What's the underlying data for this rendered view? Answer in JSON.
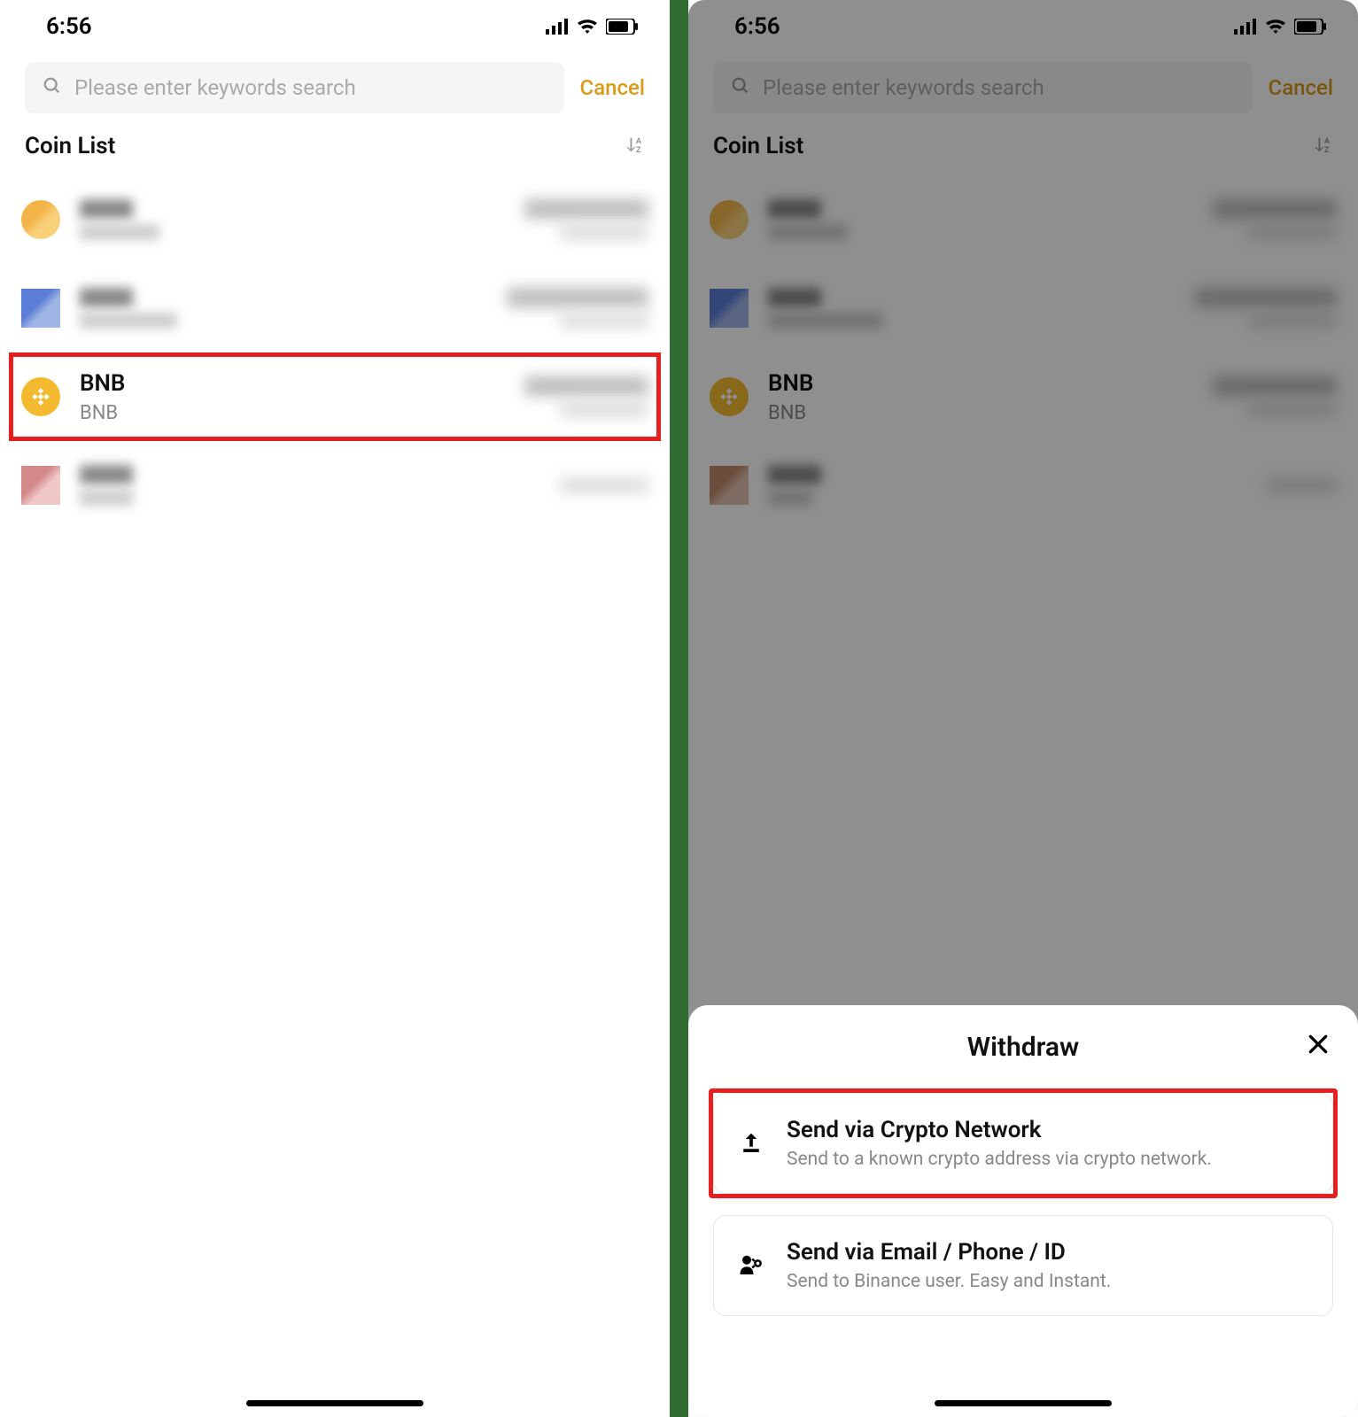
{
  "status": {
    "time": "6:56"
  },
  "search": {
    "placeholder": "Please enter keywords search",
    "cancel": "Cancel"
  },
  "list": {
    "header": "Coin List"
  },
  "coins": {
    "bnb": {
      "symbol": "BNB",
      "name": "BNB"
    }
  },
  "sheet": {
    "title": "Withdraw",
    "option1": {
      "title": "Send via Crypto Network",
      "sub": "Send to a known crypto address via crypto network."
    },
    "option2": {
      "title": "Send via Email / Phone / ID",
      "sub": "Send to Binance user. Easy and Instant."
    }
  }
}
